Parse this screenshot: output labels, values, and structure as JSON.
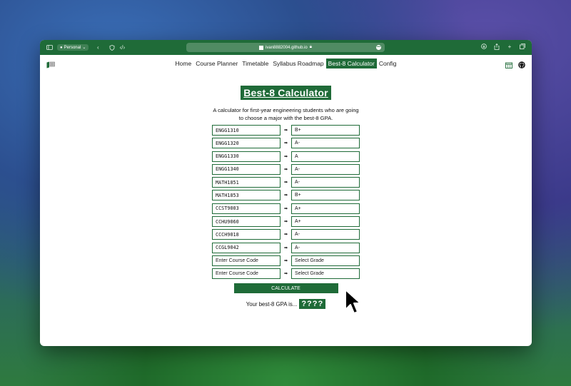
{
  "browser": {
    "profile_label": "Personal",
    "url": "ivan8882004.github.io"
  },
  "nav": {
    "links": [
      "Home",
      "Course Planner",
      "Timetable",
      "Syllabus Roadmap",
      "Best-8 Calculator",
      "Config"
    ],
    "active_index": 4
  },
  "page": {
    "title": "Best-8 Calculator",
    "description": "A calculator for first-year engineering students who are going to choose a major with the best-8 GPA."
  },
  "rows": [
    {
      "course": "ENGG1310",
      "grade": "B+"
    },
    {
      "course": "ENGG1320",
      "grade": "A-"
    },
    {
      "course": "ENGG1330",
      "grade": "A"
    },
    {
      "course": "ENGG1340",
      "grade": "A-"
    },
    {
      "course": "MATH1851",
      "grade": "A-"
    },
    {
      "course": "MATH1853",
      "grade": "B+"
    },
    {
      "course": "CCST9003",
      "grade": "A+"
    },
    {
      "course": "CCHU9060",
      "grade": "A+"
    },
    {
      "course": "CCCH9018",
      "grade": "A-"
    },
    {
      "course": "CCGL9042",
      "grade": "A-"
    }
  ],
  "empty_rows": [
    {
      "course_placeholder": "Enter Course Code",
      "grade_placeholder": "Select Grade"
    },
    {
      "course_placeholder": "Enter Course Code",
      "grade_placeholder": "Select Grade"
    }
  ],
  "arrow_glyph": "➡",
  "calculate_label": "CALCULATE",
  "result": {
    "label": "Your best-8 GPA is...",
    "value": "????"
  },
  "colors": {
    "accent": "#1f6b38"
  }
}
